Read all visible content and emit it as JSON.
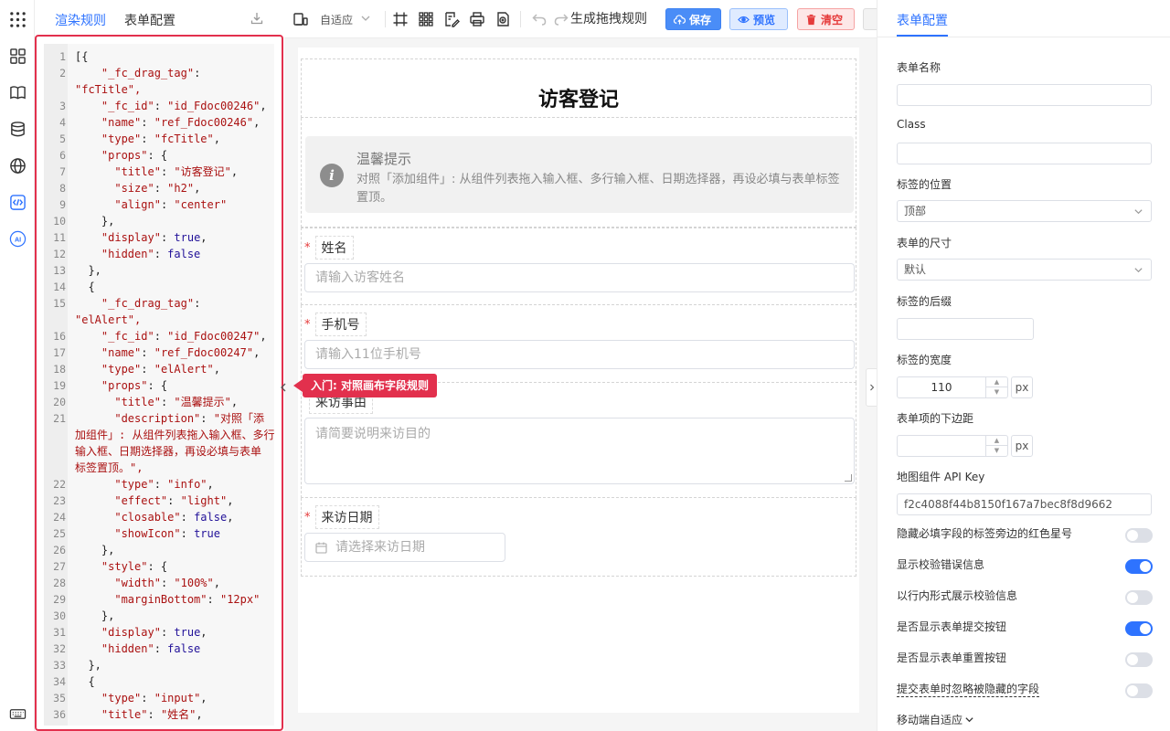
{
  "rail": {
    "icons": [
      "apps-grid-icon",
      "components-icon",
      "book-icon",
      "database-icon",
      "globe-icon",
      "code-icon",
      "ai-icon",
      "keyboard-icon"
    ],
    "ai_label": "AI"
  },
  "code_panel": {
    "tabs": [
      "渲染规则",
      "表单配置"
    ],
    "lines": [
      {
        "n": "1",
        "t": "[{"
      },
      {
        "n": "2",
        "t": "    \"_fc_drag_tag\":"
      },
      {
        "n": "",
        "t": "\"fcTitle\","
      },
      {
        "n": "3",
        "t": "    \"_fc_id\": \"id_Fdoc00246\","
      },
      {
        "n": "4",
        "t": "    \"name\": \"ref_Fdoc00246\","
      },
      {
        "n": "5",
        "t": "    \"type\": \"fcTitle\","
      },
      {
        "n": "6",
        "t": "    \"props\": {"
      },
      {
        "n": "7",
        "t": "      \"title\": \"访客登记\","
      },
      {
        "n": "8",
        "t": "      \"size\": \"h2\","
      },
      {
        "n": "9",
        "t": "      \"align\": \"center\""
      },
      {
        "n": "10",
        "t": "    },"
      },
      {
        "n": "11",
        "t": "    \"display\": true,"
      },
      {
        "n": "12",
        "t": "    \"hidden\": false"
      },
      {
        "n": "13",
        "t": "  },"
      },
      {
        "n": "14",
        "t": "  {"
      },
      {
        "n": "15",
        "t": "    \"_fc_drag_tag\":"
      },
      {
        "n": "",
        "t": "\"elAlert\","
      },
      {
        "n": "16",
        "t": "    \"_fc_id\": \"id_Fdoc00247\","
      },
      {
        "n": "17",
        "t": "    \"name\": \"ref_Fdoc00247\","
      },
      {
        "n": "18",
        "t": "    \"type\": \"elAlert\","
      },
      {
        "n": "19",
        "t": "    \"props\": {"
      },
      {
        "n": "20",
        "t": "      \"title\": \"温馨提示\","
      },
      {
        "n": "21",
        "t": "      \"description\": \"对照「添"
      },
      {
        "n": "",
        "t": "加组件」: 从组件列表拖入输入框、多行"
      },
      {
        "n": "",
        "t": "输入框、日期选择器，再设必填与表单"
      },
      {
        "n": "",
        "t": "标签置顶。\","
      },
      {
        "n": "22",
        "t": "      \"type\": \"info\","
      },
      {
        "n": "23",
        "t": "      \"effect\": \"light\","
      },
      {
        "n": "24",
        "t": "      \"closable\": false,"
      },
      {
        "n": "25",
        "t": "      \"showIcon\": true"
      },
      {
        "n": "26",
        "t": "    },"
      },
      {
        "n": "27",
        "t": "    \"style\": {"
      },
      {
        "n": "28",
        "t": "      \"width\": \"100%\","
      },
      {
        "n": "29",
        "t": "      \"marginBottom\": \"12px\""
      },
      {
        "n": "30",
        "t": "    },"
      },
      {
        "n": "31",
        "t": "    \"display\": true,"
      },
      {
        "n": "32",
        "t": "    \"hidden\": false"
      },
      {
        "n": "33",
        "t": "  },"
      },
      {
        "n": "34",
        "t": "  {"
      },
      {
        "n": "35",
        "t": "    \"type\": \"input\","
      },
      {
        "n": "36",
        "t": "    \"title\": \"姓名\","
      }
    ]
  },
  "toolbar": {
    "adapt_label": "自适应",
    "generate_label": "生成拖拽规则",
    "save_label": "保存",
    "preview_label": "预览",
    "clear_label": "清空"
  },
  "canvas": {
    "form_title": "访客登记",
    "alert": {
      "icon_glyph": "i",
      "title": "温馨提示",
      "description": "对照「添加组件」: 从组件列表拖入输入框、多行输入框、日期选择器，再设必填与表单标签置顶。"
    },
    "fields": [
      {
        "label": "姓名",
        "required_mark": "*",
        "placeholder": "请输入访客姓名"
      },
      {
        "label": "手机号",
        "required_mark": "*",
        "placeholder": "请输入11位手机号"
      },
      {
        "label": "来访事由",
        "required_mark": "",
        "placeholder": "请简要说明来访目的"
      },
      {
        "label": "来访日期",
        "required_mark": "*",
        "placeholder": "请选择来访日期"
      }
    ]
  },
  "tooltip": "入门: 对照画布字段规则",
  "right_panel": {
    "tab": "表单配置",
    "form_name_label": "表单名称",
    "form_name_value": "",
    "class_label": "Class",
    "class_value": "",
    "label_position_label": "标签的位置",
    "label_position_value": "顶部",
    "form_size_label": "表单的尺寸",
    "form_size_value": "默认",
    "label_suffix_label": "标签的后缀",
    "label_suffix_value": "",
    "label_width_label": "标签的宽度",
    "label_width_value": "110",
    "px_unit": "px",
    "item_margin_label": "表单项的下边距",
    "item_margin_value": "",
    "map_key_label": "地图组件 API Key",
    "map_key_value": "f2c4088f44b8150f167a7bec8f8d9662",
    "toggles": [
      {
        "label": "隐藏必填字段的标签旁边的红色星号",
        "on": false
      },
      {
        "label": "显示校验错误信息",
        "on": true
      },
      {
        "label": "以行内形式展示校验信息",
        "on": false
      },
      {
        "label": "是否显示表单提交按钮",
        "on": true
      },
      {
        "label": "是否显示表单重置按钮",
        "on": false
      },
      {
        "label": "提交表单时忽略被隐藏的字段",
        "on": false
      }
    ],
    "mobile_label": "移动端自适应"
  },
  "colors": {
    "accent": "#2e73ff",
    "highlight": "#e2304d",
    "danger": "#e53b3b"
  }
}
